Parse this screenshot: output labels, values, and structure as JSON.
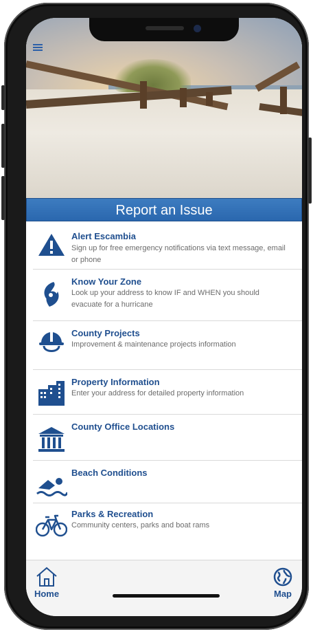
{
  "banner": {
    "title": "Report an Issue"
  },
  "menu": {
    "items": [
      {
        "icon": "warning-icon",
        "title": "Alert Escambia",
        "desc": "Sign up for free emergency notifications via text message, email or phone"
      },
      {
        "icon": "hurricane-icon",
        "title": "Know Your Zone",
        "desc": "Look up your address to know IF and WHEN you should evacuate for a hurricane"
      },
      {
        "icon": "hard-hat-icon",
        "title": "County Projects",
        "desc": "Improvement & maintenance projects information"
      },
      {
        "icon": "buildings-icon",
        "title": "Property Information",
        "desc": "Enter your address for detailed property information"
      },
      {
        "icon": "courthouse-icon",
        "title": "County Office Locations",
        "desc": ""
      },
      {
        "icon": "swimmer-icon",
        "title": "Beach Conditions",
        "desc": ""
      },
      {
        "icon": "bicycle-icon",
        "title": "Parks & Recreation",
        "desc": "Community centers, parks and boat rams"
      }
    ]
  },
  "tabbar": {
    "home_label": "Home",
    "map_label": "Map"
  },
  "colors": {
    "primary": "#204f8f",
    "banner": "#2a67ae"
  }
}
